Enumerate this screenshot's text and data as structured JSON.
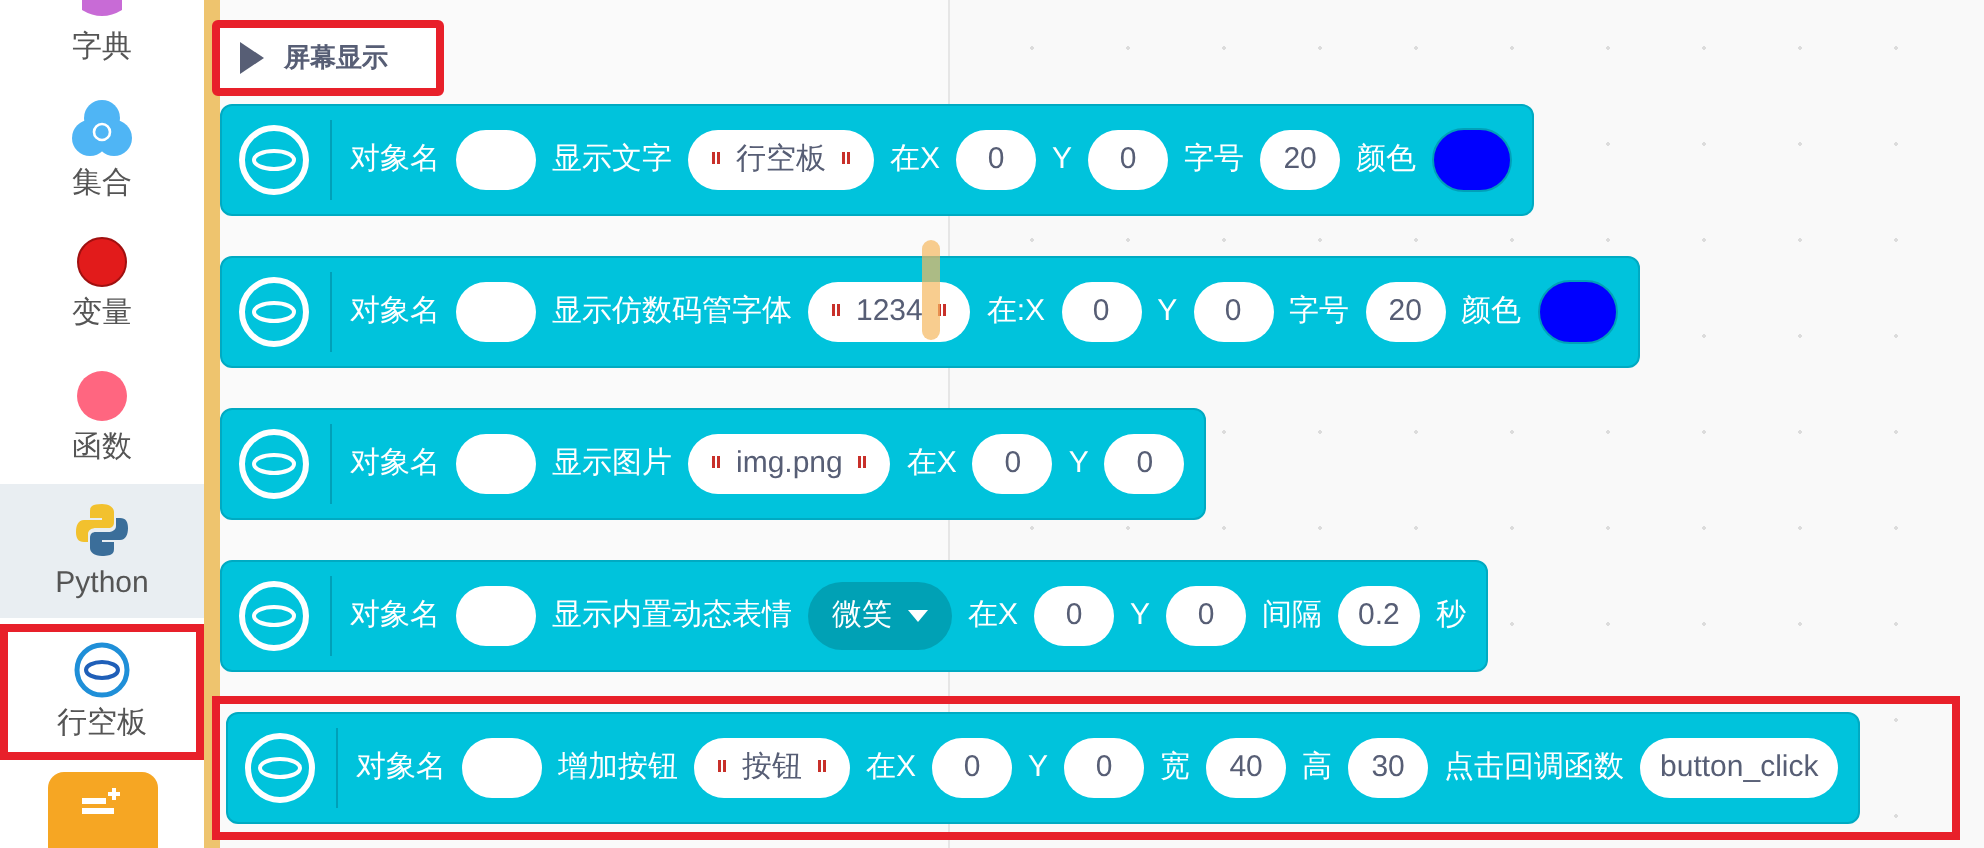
{
  "sidebar": {
    "items": [
      {
        "label": "字典",
        "selected": false,
        "highlighted": false
      },
      {
        "label": "集合",
        "selected": false,
        "highlighted": false
      },
      {
        "label": "变量",
        "selected": false,
        "highlighted": false
      },
      {
        "label": "函数",
        "selected": false,
        "highlighted": false
      },
      {
        "label": "Python",
        "selected": true,
        "highlighted": false
      },
      {
        "label": "行空板",
        "selected": false,
        "highlighted": true
      }
    ]
  },
  "flyout": {
    "section": {
      "label": "屏幕显示",
      "highlighted": true
    },
    "blocks": [
      {
        "highlighted": false,
        "parts": [
          {
            "kind": "label",
            "text": "对象名"
          },
          {
            "kind": "empty_input"
          },
          {
            "kind": "label",
            "text": "显示文字"
          },
          {
            "kind": "string",
            "text": "行空板"
          },
          {
            "kind": "label",
            "text": "在X"
          },
          {
            "kind": "input",
            "text": "0"
          },
          {
            "kind": "label",
            "text": "Y"
          },
          {
            "kind": "input",
            "text": "0"
          },
          {
            "kind": "label",
            "text": "字号"
          },
          {
            "kind": "input",
            "text": "20"
          },
          {
            "kind": "label",
            "text": "颜色"
          },
          {
            "kind": "color",
            "color": "#0000ff"
          }
        ]
      },
      {
        "highlighted": false,
        "parts": [
          {
            "kind": "label",
            "text": "对象名"
          },
          {
            "kind": "empty_input"
          },
          {
            "kind": "label",
            "text": "显示仿数码管字体"
          },
          {
            "kind": "string",
            "text": "1234"
          },
          {
            "kind": "label",
            "text": "在:X"
          },
          {
            "kind": "input",
            "text": "0"
          },
          {
            "kind": "label",
            "text": "Y"
          },
          {
            "kind": "input",
            "text": "0"
          },
          {
            "kind": "label",
            "text": "字号"
          },
          {
            "kind": "input",
            "text": "20"
          },
          {
            "kind": "label",
            "text": "颜色"
          },
          {
            "kind": "color",
            "color": "#0000ff"
          }
        ]
      },
      {
        "highlighted": false,
        "parts": [
          {
            "kind": "label",
            "text": "对象名"
          },
          {
            "kind": "empty_input"
          },
          {
            "kind": "label",
            "text": "显示图片"
          },
          {
            "kind": "string",
            "text": "img.png"
          },
          {
            "kind": "label",
            "text": "在X"
          },
          {
            "kind": "input",
            "text": "0"
          },
          {
            "kind": "label",
            "text": "Y"
          },
          {
            "kind": "input",
            "text": "0"
          }
        ]
      },
      {
        "highlighted": false,
        "parts": [
          {
            "kind": "label",
            "text": "对象名"
          },
          {
            "kind": "empty_input"
          },
          {
            "kind": "label",
            "text": "显示内置动态表情"
          },
          {
            "kind": "dropdown",
            "text": "微笑"
          },
          {
            "kind": "label",
            "text": "在X"
          },
          {
            "kind": "input",
            "text": "0"
          },
          {
            "kind": "label",
            "text": "Y"
          },
          {
            "kind": "input",
            "text": "0"
          },
          {
            "kind": "label",
            "text": "间隔"
          },
          {
            "kind": "input",
            "text": "0.2"
          },
          {
            "kind": "label",
            "text": "秒"
          }
        ]
      },
      {
        "highlighted": true,
        "parts": [
          {
            "kind": "label",
            "text": "对象名"
          },
          {
            "kind": "empty_input"
          },
          {
            "kind": "label",
            "text": "增加按钮"
          },
          {
            "kind": "string",
            "text": "按钮"
          },
          {
            "kind": "label",
            "text": "在X"
          },
          {
            "kind": "input",
            "text": "0"
          },
          {
            "kind": "label",
            "text": "Y"
          },
          {
            "kind": "input",
            "text": "0"
          },
          {
            "kind": "label",
            "text": "宽"
          },
          {
            "kind": "input",
            "text": "40"
          },
          {
            "kind": "label",
            "text": "高"
          },
          {
            "kind": "input",
            "text": "30"
          },
          {
            "kind": "label",
            "text": "点击回调函数"
          },
          {
            "kind": "input",
            "text": "button_click"
          }
        ]
      }
    ]
  }
}
